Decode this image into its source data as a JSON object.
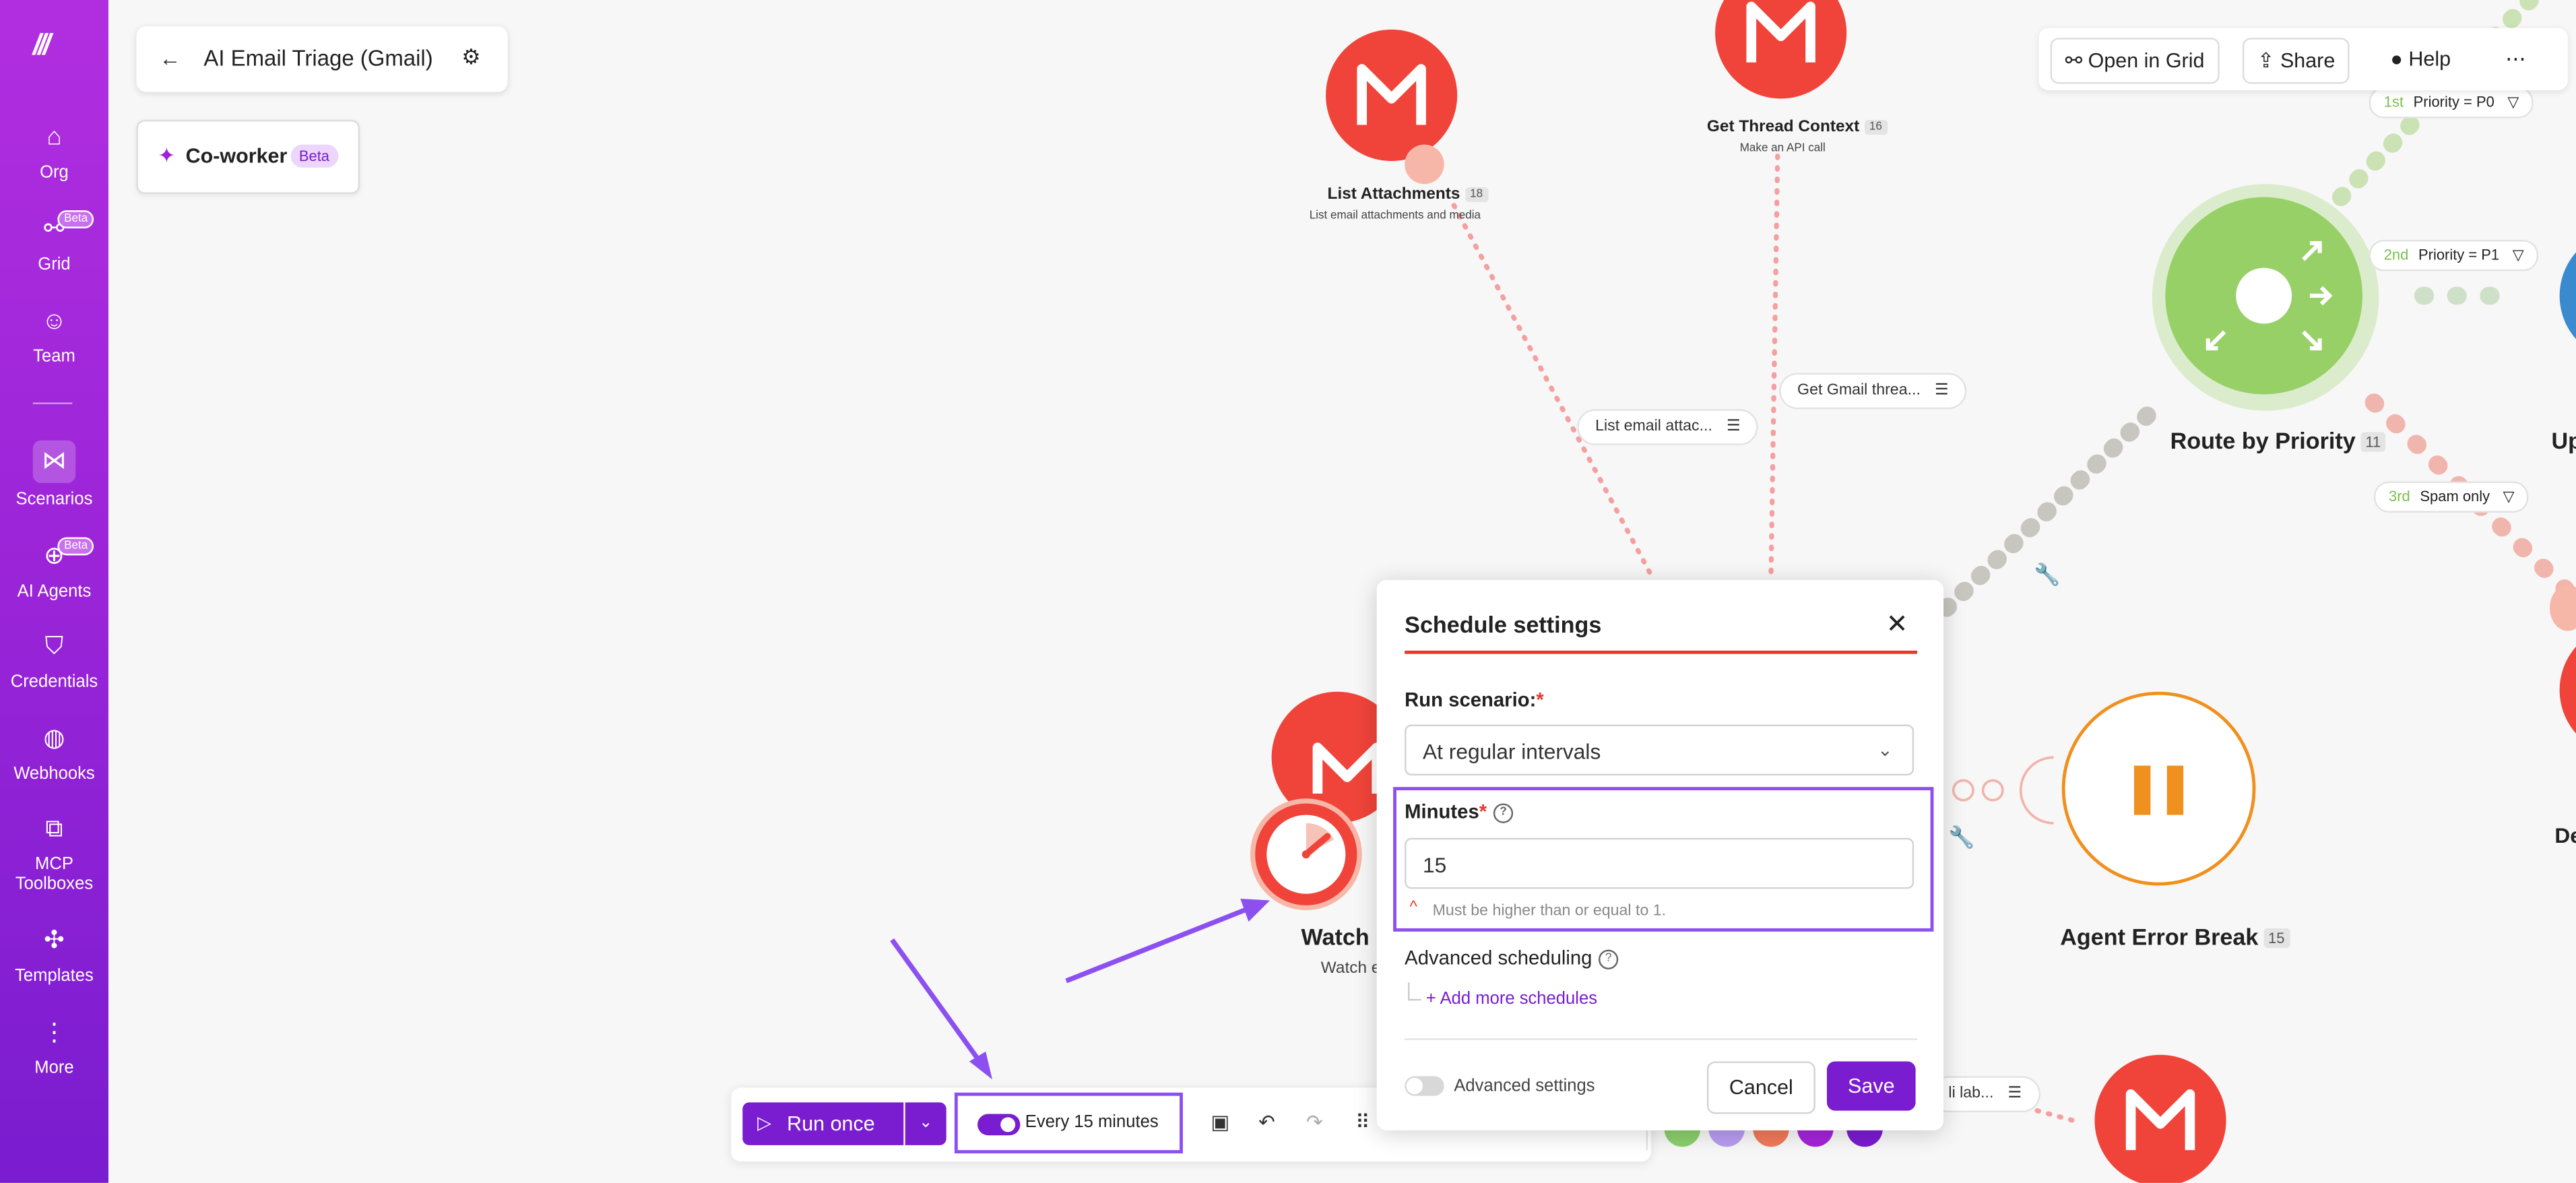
{
  "sidebar": {
    "items": [
      {
        "label": "Org",
        "icon": "home-icon"
      },
      {
        "label": "Grid",
        "icon": "grid-icon",
        "badge": "Beta"
      },
      {
        "label": "Team",
        "icon": "team-icon"
      },
      {
        "label": "Scenarios",
        "icon": "share-icon",
        "active": true
      },
      {
        "label": "AI Agents",
        "icon": "ai-agent-icon",
        "badge": "Beta"
      },
      {
        "label": "Credentials",
        "icon": "shield-icon"
      },
      {
        "label": "Webhooks",
        "icon": "globe-icon"
      },
      {
        "label": "MCP Toolboxes",
        "icon": "mcp-icon"
      },
      {
        "label": "Templates",
        "icon": "puzzle-icon"
      },
      {
        "label": "More",
        "icon": "more-vertical-icon"
      }
    ]
  },
  "header": {
    "scenario_title": "AI Email Triage (Gmail)",
    "coworker_label": "Co-worker",
    "coworker_badge": "Beta",
    "open_grid": "Open in Grid",
    "share": "Share",
    "help": "Help"
  },
  "nodes": {
    "list_attachments": {
      "title": "List Attachments",
      "count": "18",
      "subtitle": "List email attachments and media"
    },
    "thread_context": {
      "title": "Get Thread Context",
      "count": "16",
      "subtitle": "Make an API call"
    },
    "route_priority": {
      "title": "Route by Priority",
      "count": "11"
    },
    "agent_error": {
      "title": "Agent Error Break",
      "count": "15"
    },
    "watch": {
      "title": "Watch",
      "subtitle": "Watch e"
    },
    "partial_right_1": "Up",
    "partial_right_2": "De"
  },
  "chips": {
    "list_email": "List email attac...",
    "get_gmail": "Get Gmail threa...",
    "bottom_chip": "li lab..."
  },
  "filters": [
    {
      "order": "1st",
      "label": "Priority = P0"
    },
    {
      "order": "2nd",
      "label": "Priority = P1"
    },
    {
      "order": "3rd",
      "label": "Spam only"
    }
  ],
  "modal": {
    "title": "Schedule settings",
    "run_scenario_label": "Run scenario:",
    "run_scenario_value": "At regular intervals",
    "minutes_label": "Minutes",
    "minutes_value": "15",
    "minutes_hint": "Must be higher than or equal to 1.",
    "advanced_scheduling_label": "Advanced scheduling",
    "add_more": "Add more schedules",
    "advanced_settings": "Advanced settings",
    "cancel": "Cancel",
    "save": "Save"
  },
  "bottombar": {
    "run_once": "Run once",
    "schedule_label": "Every 15 minutes"
  },
  "colors": {
    "sidebar_top": "#b12ee0",
    "sidebar_bottom": "#7a1ccf",
    "gmail_red": "#f0443a",
    "router_green": "#96d066",
    "error_orange": "#f0901e",
    "accent_purple": "#7a1ccf",
    "annotation_purple": "#8c50f0"
  }
}
